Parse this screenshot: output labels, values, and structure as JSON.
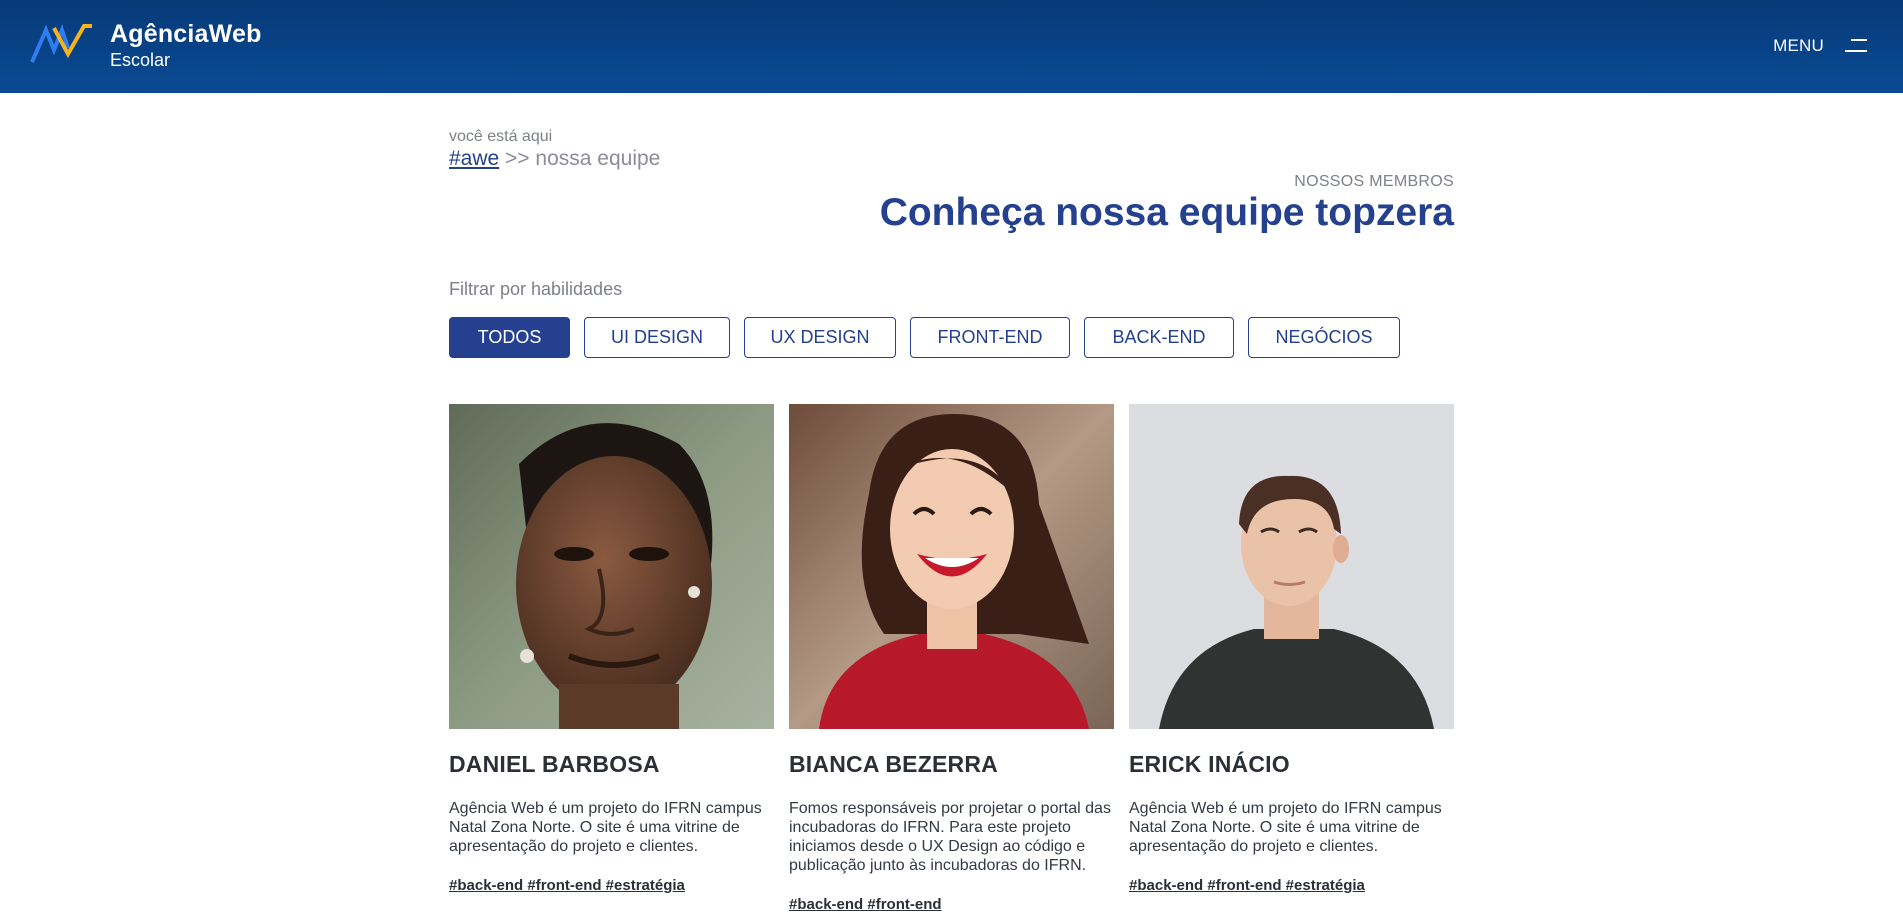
{
  "brand": {
    "title": "AgênciaWeb",
    "subtitle": "Escolar",
    "colors": {
      "header": "#0a4a93",
      "accent_blue": "#2f7df2",
      "accent_yellow": "#f5b321",
      "primary": "#24408e"
    }
  },
  "menu": {
    "label": "MENU",
    "icon": "hamburger-icon"
  },
  "breadcrumb": {
    "prefix": "você está aqui",
    "home_link": "#awe",
    "separator_current": ">> nossa equipe"
  },
  "heading": {
    "eyebrow": "NOSSOS MEMBROS",
    "title": "Conheça nossa equipe topzera"
  },
  "filters": {
    "label": "Filtrar por habilidades",
    "items": [
      {
        "label": "TODOS",
        "active": true
      },
      {
        "label": "UI DESIGN",
        "active": false
      },
      {
        "label": "UX DESIGN",
        "active": false
      },
      {
        "label": "FRONT-END",
        "active": false
      },
      {
        "label": "BACK-END",
        "active": false
      },
      {
        "label": "NEGÓCIOS",
        "active": false
      }
    ]
  },
  "members": [
    {
      "name": "DANIEL BARBOSA",
      "photo": "portrait-man-braids",
      "bio": "Agência Web é um projeto do IFRN campus Natal Zona Norte. O site é uma vitrine de apresentação do projeto e clientes.",
      "tags": "#back-end #front-end #estratégia"
    },
    {
      "name": "BIANCA BEZERRA",
      "photo": "portrait-woman-smiling",
      "bio": "Fomos responsáveis por projetar o portal das incubadoras do IFRN. Para este projeto iniciamos desde o UX Design ao código e publicação junto às incubadoras do IFRN.",
      "tags": "#back-end #front-end"
    },
    {
      "name": "ERICK INÁCIO",
      "photo": "portrait-young-man",
      "bio": "Agência Web é um projeto do IFRN campus Natal Zona Norte. O site é uma vitrine de apresentação do projeto e clientes.",
      "tags": "#back-end #front-end #estratégia"
    }
  ]
}
